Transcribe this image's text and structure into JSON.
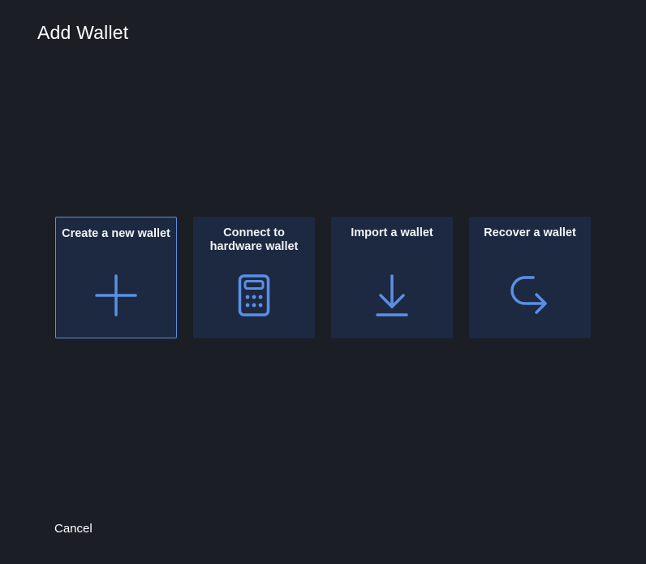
{
  "window": {
    "title": "Add Wallet"
  },
  "options": [
    {
      "label": "Create a new wallet",
      "icon": "plus-icon",
      "selected": true
    },
    {
      "label": "Connect to hardware wallet",
      "icon": "hardware-wallet-icon",
      "selected": false
    },
    {
      "label": "Import a wallet",
      "icon": "download-icon",
      "selected": false
    },
    {
      "label": "Recover a wallet",
      "icon": "redirect-arrow-icon",
      "selected": false
    }
  ],
  "footer": {
    "cancel_label": "Cancel"
  },
  "colors": {
    "background": "#1b1e25",
    "card": "#1c2940",
    "accent": "#5b8fe6",
    "text": "#ffffff"
  }
}
